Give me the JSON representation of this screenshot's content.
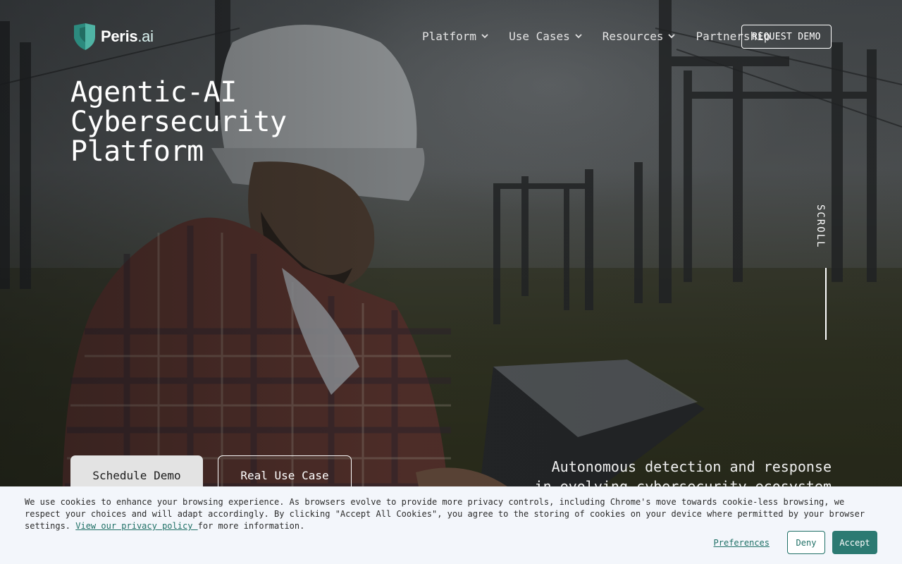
{
  "brand": {
    "name": "Peris",
    "suffix": ".ai",
    "accent": "#2c7a72"
  },
  "nav": {
    "items": [
      {
        "label": "Platform",
        "has_dropdown": true
      },
      {
        "label": "Use Cases",
        "has_dropdown": true
      },
      {
        "label": "Resources",
        "has_dropdown": true
      },
      {
        "label": "Partnership",
        "has_dropdown": false
      }
    ],
    "cta": "REQUEST DEMO"
  },
  "hero": {
    "title_lines": [
      "Agentic-AI",
      "Cybersecurity",
      "Platform"
    ],
    "scroll_label": "SCROLL",
    "primary_button": "Schedule Demo",
    "secondary_button": "Real Use Case",
    "tagline_line1": "Autonomous detection and response",
    "tagline_line2": "in evolving cybersecurity ecosystem"
  },
  "cookie_banner": {
    "text": "We use cookies to enhance your browsing experience. As browsers evolve to provide more privacy controls, including Chrome's move towards cookie-less browsing, we respect your choices and will adapt accordingly. By clicking \"Accept All Cookies\", you agree to the storing of cookies on your device where permitted by your browser settings. ",
    "link_text": "View our privacy policy ",
    "text_after": "for more information.",
    "preferences": "Preferences",
    "deny": "Deny",
    "accept": "Accept"
  }
}
